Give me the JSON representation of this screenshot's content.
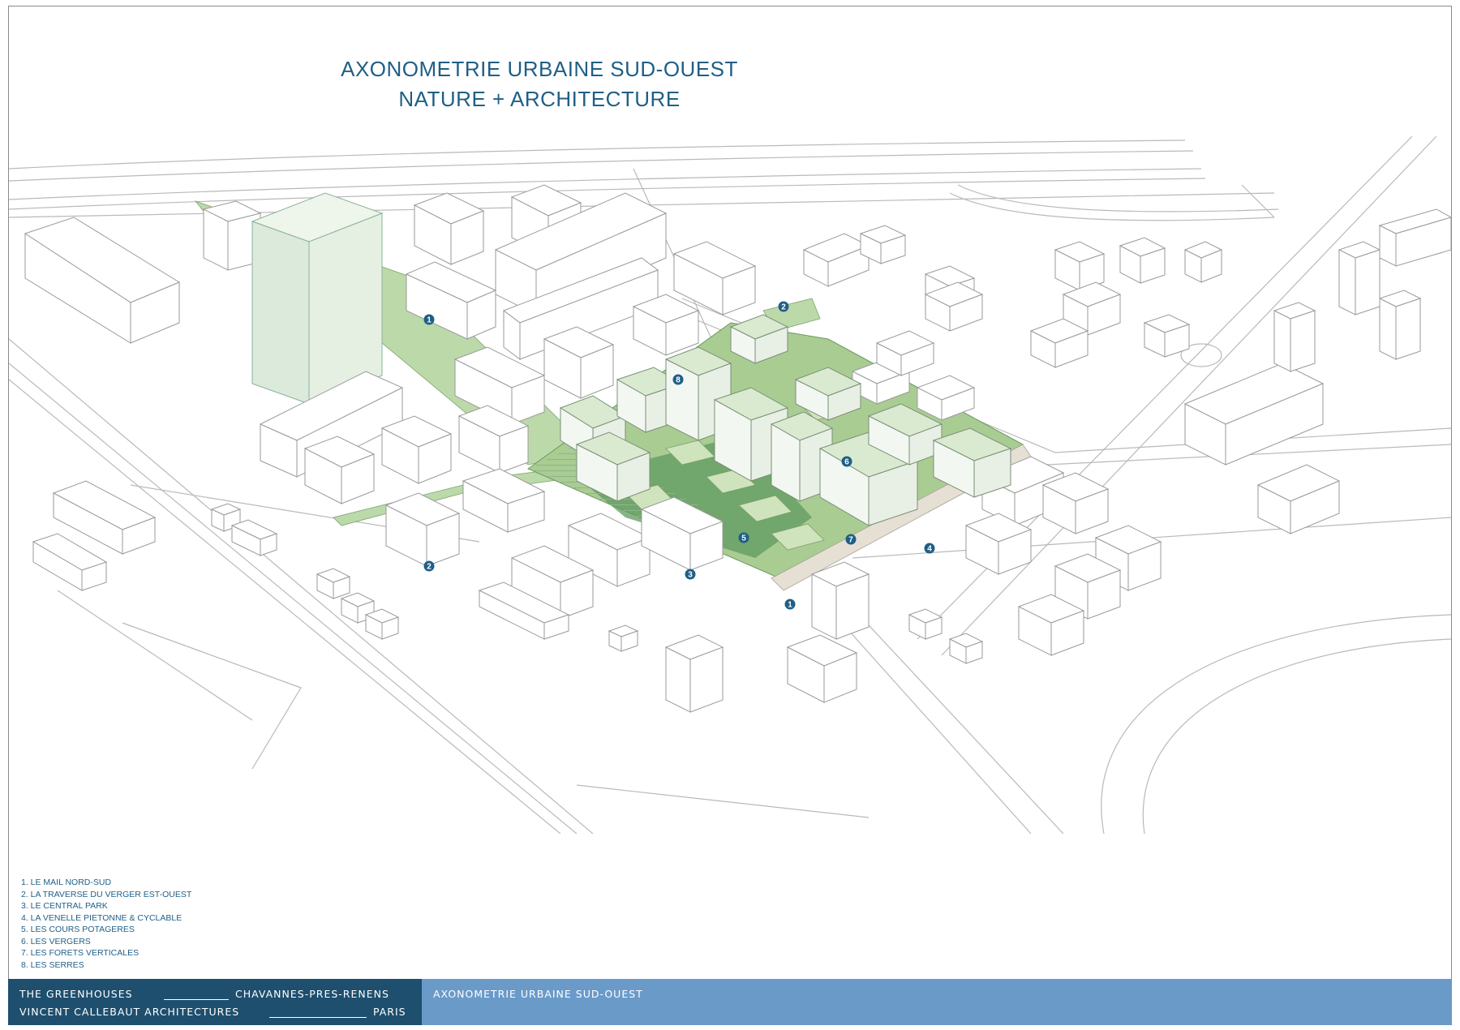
{
  "header": {
    "title": "AXONOMETRIE URBAINE SUD-OUEST",
    "subtitle": "NATURE + ARCHITECTURE"
  },
  "markers": [
    "1",
    "2",
    "2",
    "8",
    "6",
    "5",
    "7",
    "3",
    "1",
    "4"
  ],
  "legend": [
    "1. LE MAIL NORD-SUD",
    "2. LA TRAVERSE DU VERGER EST-OUEST",
    "3. LE CENTRAL PARK",
    "4. LA VENELLE PIETONNE & CYCLABLE",
    "5. LES COURS POTAGERES",
    "6. LES VERGERS",
    "7. LES FORETS VERTICALES",
    "8. LES SERRES"
  ],
  "footer": {
    "project": "THE GREENHOUSES",
    "location": "CHAVANNES-PRES-RENENS",
    "architect": "VINCENT CALLEBAUT ARCHITECTURES",
    "city": "PARIS",
    "sheet_title": "AXONOMETRIE URBAINE SUD-OUEST"
  },
  "colors": {
    "title": "#1f5f86",
    "footer_left": "#1e4f6e",
    "footer_right": "#6a9ac8",
    "park_light": "#a9cc93",
    "park_dark": "#5f9a5f",
    "marker": "#1f5f86",
    "building_line": "#9a9a9a"
  }
}
